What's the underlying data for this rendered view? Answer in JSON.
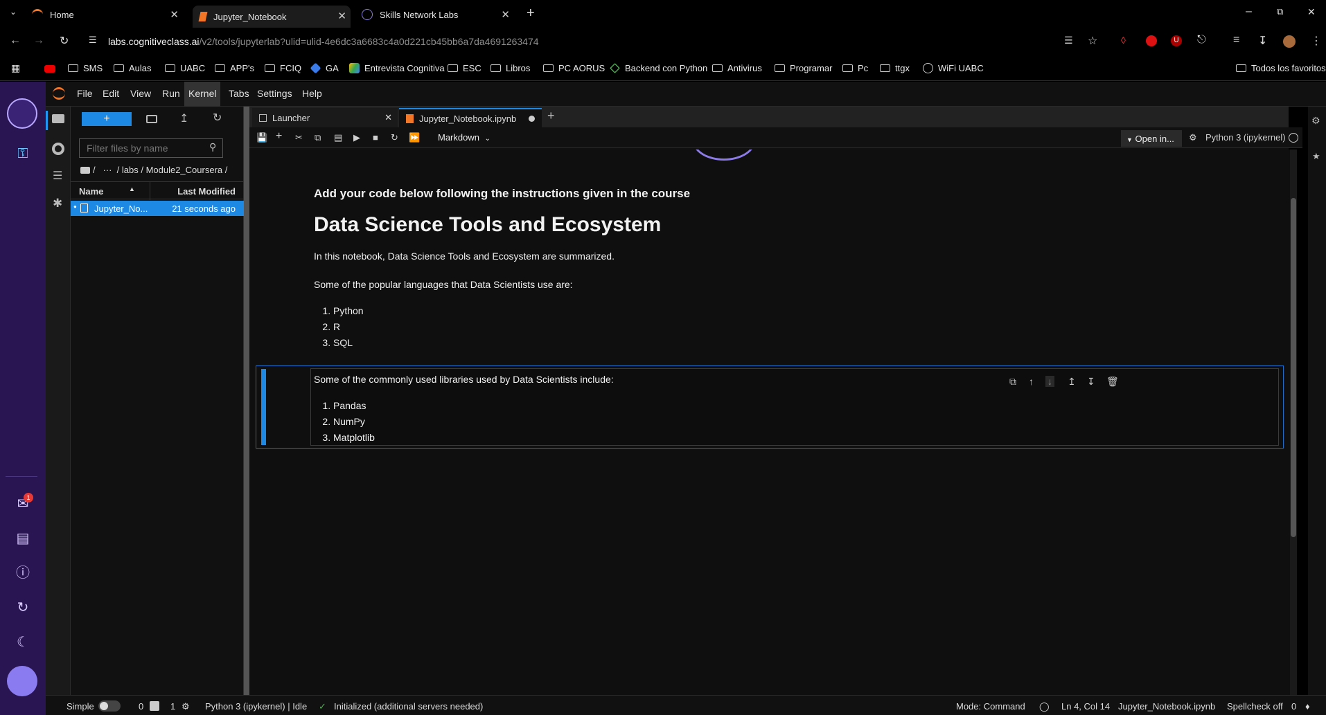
{
  "browser": {
    "tabs": [
      {
        "label": "Home"
      },
      {
        "label": "Jupyter_Notebook"
      },
      {
        "label": "Skills Network Labs"
      }
    ],
    "url_host": "labs.cognitiveclass.ai",
    "url_path": "/v2/tools/jupyterlab?ulid=ulid-4e6dc3a6683c4a0d221cb45bb6a7da4691263474",
    "bookmarks": [
      "SMS",
      "Aulas",
      "UABC",
      "APP's",
      "FCIQ",
      "GA",
      "Entrevista Cognitiva",
      "ESC",
      "Libros",
      "PC AORUS",
      "Backend con Python",
      "Antivirus",
      "Programar",
      "Pc",
      "ttgx",
      "WiFi UABC"
    ],
    "all_bookmarks": "Todos los favoritos"
  },
  "sidebar": {
    "notification_count": "1"
  },
  "jupyter": {
    "menu": [
      "File",
      "Edit",
      "View",
      "Run",
      "Kernel",
      "Tabs",
      "Settings",
      "Help"
    ],
    "filebrowser": {
      "filter_placeholder": "Filter files by name",
      "breadcrumb": "/   ···  / labs / Module2_Coursera /",
      "col_name": "Name",
      "col_modified": "Last Modified",
      "files": [
        {
          "name": "Jupyter_No...",
          "modified": "21 seconds ago"
        }
      ]
    },
    "doc_tabs": [
      {
        "label": "Launcher"
      },
      {
        "label": "Jupyter_Notebook.ipynb"
      }
    ],
    "toolbar": {
      "cell_type": "Markdown",
      "open_in": "Open in...",
      "kernel": "Python 3 (ipykernel)"
    },
    "notebook": {
      "intro": "Add your code below following the instructions given in the course",
      "title": "Data Science Tools and Ecosystem",
      "para1": "In this notebook, Data Science Tools and Ecosystem are summarized.",
      "para2": "Some of the popular languages that Data Scientists use are:",
      "languages": [
        "Python",
        "R",
        "SQL"
      ],
      "para3": "Some of the commonly used libraries used by Data Scientists include:",
      "libraries": [
        "Pandas",
        "NumPy",
        "Matplotlib"
      ]
    },
    "status": {
      "mode": "Simple",
      "terminals": "0",
      "kernels": "1",
      "kernel_status": "Python 3 (ipykernel) | Idle",
      "init": "Initialized (additional servers needed)",
      "cmd_mode": "Mode: Command",
      "position": "Ln 4, Col 14",
      "file": "Jupyter_Notebook.ipynb",
      "spell": "Spellcheck off",
      "notif": "0"
    }
  }
}
